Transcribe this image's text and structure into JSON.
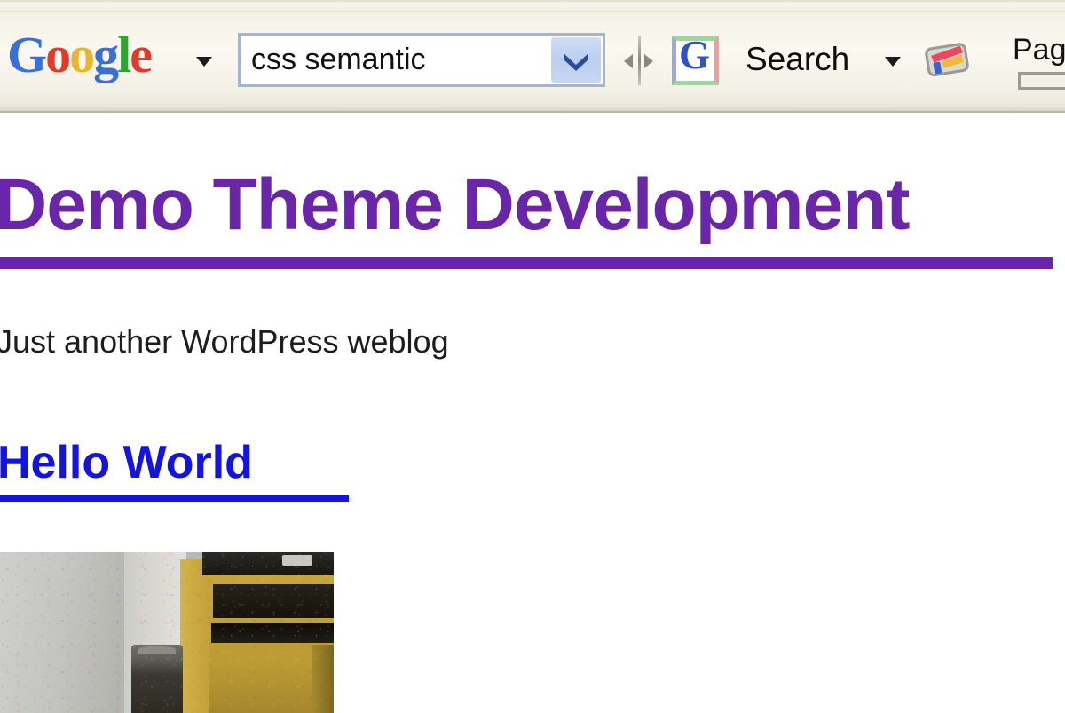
{
  "toolbar": {
    "name": "google-toolbar",
    "logo": {
      "text": "Google",
      "letters": [
        {
          "char": "G",
          "color": "#3a6fd8"
        },
        {
          "char": "o",
          "color": "#e03b28"
        },
        {
          "char": "o",
          "color": "#e8b52c"
        },
        {
          "char": "g",
          "color": "#3a6fd8"
        },
        {
          "char": "l",
          "color": "#2ea531"
        },
        {
          "char": "e",
          "color": "#e03b28"
        }
      ]
    },
    "search": {
      "value": "css semantic",
      "placeholder": "",
      "dropdown_icon": "chevron-down-icon"
    },
    "search_button_label": "Search",
    "g_icon_letter": "G",
    "pagerank_label": "Pag",
    "highlight_icon": "highlighter-icon",
    "drag_handle_icon": "drag-handle-icon",
    "background_color": "#f4f2e8"
  },
  "page": {
    "blog_title": "Demo Theme Development",
    "blog_title_color": "#6a26a8",
    "tagline": "Just another WordPress weblog",
    "post_title": "Hello World",
    "post_title_color": "#1414e0",
    "photo_alt": "room-interior-photo"
  }
}
